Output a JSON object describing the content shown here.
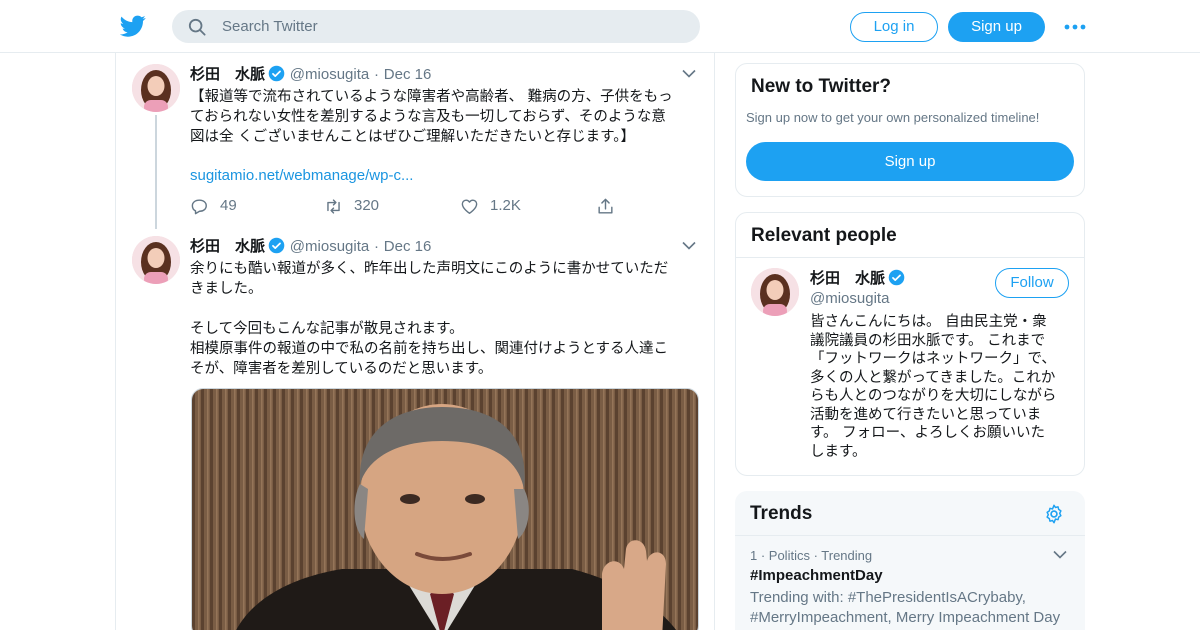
{
  "header": {
    "search_placeholder": "Search Twitter",
    "login_label": "Log in",
    "signup_label": "Sign up",
    "more_icon": "more-dots-icon",
    "accent_color": "#1da1f2"
  },
  "timeline": {
    "tweets": [
      {
        "author_name": "杉田　水脈",
        "verified": true,
        "handle": "@miosugita",
        "separator": "·",
        "date": "Dec 16",
        "text_lines": [
          "【報道等で流布されているような障害者や高齢者、 難病の方、子供をもっ",
          "ておられない女性を差別するような言及も一切しておらず、そのような意",
          "図は全 くございませんことはぜひご理解いただきたいと存じます。】"
        ],
        "link": "sugitamio.net/webmanage/wp-c...",
        "replies": "49",
        "retweets": "320",
        "likes": "1.2K"
      },
      {
        "author_name": "杉田　水脈",
        "verified": true,
        "handle": "@miosugita",
        "separator": "·",
        "date": "Dec 16",
        "text_lines": [
          "余りにも酷い報道が多く、昨年出した声明文にこのように書かせていただ",
          "きました。",
          "",
          "そして今回もこんな記事が散見されます。",
          "相模原事件の報道の中で私の名前を持ち出し、関連付けようとする人達こ",
          "そが、障害者を差別しているのだと思います。"
        ]
      }
    ]
  },
  "sidebar": {
    "new_to_twitter": {
      "title": "New to Twitter?",
      "subtitle": "Sign up now to get your own personalized timeline!",
      "signup_label": "Sign up"
    },
    "relevant_people": {
      "title": "Relevant people",
      "name": "杉田　水脈",
      "handle": "@miosugita",
      "follow_label": "Follow",
      "bio_lines": [
        "皆さんこんにちは。 自由民主党・衆",
        "議院議員の杉田水脈です。 これまで",
        "「フットワークはネットワーク」で、",
        "多くの人と繋がってきました。これか",
        "らも人とのつながりを大切にしながら",
        "活動を進めて行きたいと思っていま",
        "す。 フォロー、よろしくお願いいた",
        "します。"
      ]
    },
    "trends": {
      "title": "Trends",
      "items": [
        {
          "meta": "1 · Politics · Trending",
          "name": "#ImpeachmentDay",
          "with_line1": "Trending with: #ThePresidentIsACrybaby,",
          "with_line2": "#MerryImpeachment, Merry Impeachment Day"
        }
      ]
    }
  }
}
